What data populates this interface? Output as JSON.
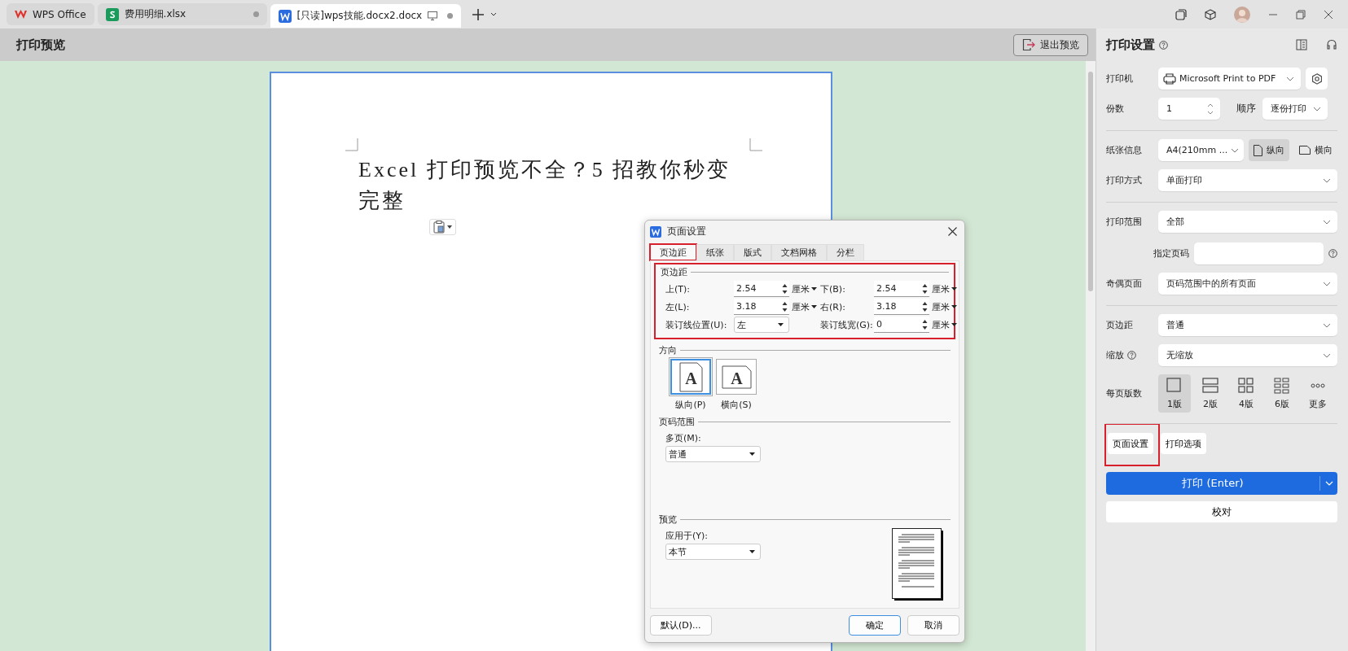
{
  "tabs": [
    {
      "kind": "wps",
      "label": "WPS Office",
      "selected": false
    },
    {
      "kind": "sheet",
      "label": "费用明细.xlsx",
      "selected": false
    },
    {
      "kind": "doc",
      "label": "[只读]wps技能.docx2.docx",
      "selected": true
    }
  ],
  "header": {
    "title": "打印预览",
    "exit_button": "退出预览"
  },
  "document": {
    "title": "Excel 打印预览不全？5 招教你秒变完整"
  },
  "dialog": {
    "title": "页面设置",
    "tabs": [
      {
        "label": "页边距",
        "selected": true,
        "highlighted": true
      },
      {
        "label": "纸张",
        "selected": false,
        "highlighted": false
      },
      {
        "label": "版式",
        "selected": false,
        "highlighted": false
      },
      {
        "label": "文档网格",
        "selected": false,
        "highlighted": false
      },
      {
        "label": "分栏",
        "selected": false,
        "highlighted": false
      }
    ],
    "margins": {
      "heading": "页边距",
      "highlighted": true,
      "fields": [
        {
          "label": "上(T):",
          "value": "2.54",
          "unit": "厘米"
        },
        {
          "label": "下(B):",
          "value": "2.54",
          "unit": "厘米"
        },
        {
          "label": "左(L):",
          "value": "3.18",
          "unit": "厘米"
        },
        {
          "label": "右(R):",
          "value": "3.18",
          "unit": "厘米"
        }
      ],
      "gutter_position": {
        "label": "装订线位置(U):",
        "value": "左"
      },
      "gutter_width": {
        "label": "装订线宽(G):",
        "value": "0",
        "unit": "厘米"
      }
    },
    "orientation": {
      "heading": "方向",
      "options": [
        {
          "kind": "portrait",
          "glyph": "A",
          "label": "纵向(P)",
          "selected": true
        },
        {
          "kind": "landscape",
          "glyph": "A",
          "label": "横向(S)",
          "selected": false
        }
      ]
    },
    "page_range": {
      "heading": "页码范围",
      "label": "多页(M):",
      "value": "普通"
    },
    "preview": {
      "heading": "预览",
      "label": "应用于(Y):",
      "value": "本节"
    },
    "buttons": {
      "default": "默认(D)...",
      "ok": "确定",
      "cancel": "取消"
    }
  },
  "panel": {
    "title": "打印设置",
    "rows": [
      {
        "kind": "printer",
        "label": "打印机",
        "value": "Microsoft Print to PDF"
      },
      {
        "kind": "copies",
        "label": "份数",
        "value": "1",
        "order_label": "顺序",
        "order_value": "逐份打印"
      },
      {
        "kind": "divider"
      },
      {
        "kind": "paper",
        "label": "纸张信息",
        "value": "A4(210mm ...",
        "orientations": [
          {
            "kind": "portrait",
            "label": "纵向",
            "selected": true
          },
          {
            "kind": "landscape",
            "label": "横向",
            "selected": false
          }
        ]
      },
      {
        "kind": "select",
        "label": "打印方式",
        "value": "单面打印"
      },
      {
        "kind": "divider"
      },
      {
        "kind": "select",
        "label": "打印范围",
        "value": "全部"
      },
      {
        "kind": "field",
        "label": "指定页码"
      },
      {
        "kind": "select",
        "label": "奇偶页面",
        "value": "页码范围中的所有页面"
      },
      {
        "kind": "divider"
      },
      {
        "kind": "select",
        "label": "页边距",
        "value": "普通"
      },
      {
        "kind": "select",
        "label": "缩放",
        "value": "无缩放",
        "help": true
      },
      {
        "kind": "layout",
        "label": "每页版数",
        "options": [
          {
            "kind": "one",
            "label": "1版",
            "selected": true
          },
          {
            "kind": "two",
            "label": "2版",
            "selected": false
          },
          {
            "kind": "four",
            "label": "4版",
            "selected": false
          },
          {
            "kind": "six",
            "label": "6版",
            "selected": false
          },
          {
            "kind": "more",
            "label": "更多",
            "selected": false
          }
        ]
      },
      {
        "kind": "divider"
      }
    ],
    "actions": [
      {
        "label": "页面设置",
        "highlighted": true
      },
      {
        "label": "打印选项",
        "highlighted": false
      }
    ],
    "print_button": "打印 (Enter)",
    "proof_button": "校对"
  }
}
